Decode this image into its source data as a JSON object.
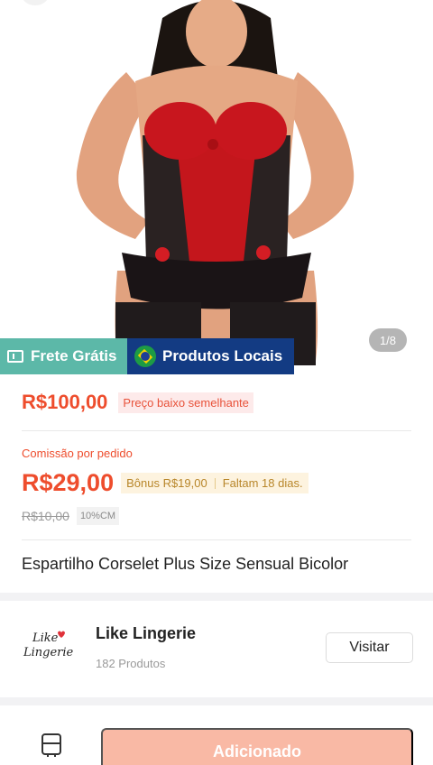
{
  "gallery": {
    "pager": "1/8",
    "tag_free_shipping": "Frete Grátis",
    "tag_local_products": "Produtos Locais"
  },
  "price": {
    "value": "R$100,00",
    "similar_badge": "Preço baixo semelhante"
  },
  "commission": {
    "label": "Comissão por pedido",
    "value": "R$29,00",
    "bonus": "Bônus R$19,00",
    "remaining": "Faltam 18 dias.",
    "old_value": "R$10,00",
    "rate": "10%CM"
  },
  "product": {
    "title": "Espartilho Corselet Plus Size Sensual Bicolor"
  },
  "shop": {
    "logo_text_line1": "Like",
    "logo_text_line2": "Lingerie",
    "name": "Like Lingerie",
    "product_count": "182 Produtos",
    "visit_label": "Visitar"
  },
  "actions": {
    "add_label": "Adicionado"
  },
  "colors": {
    "accent": "#ee4d2d",
    "free_shipping_tag": "#5cb8a8",
    "local_tag": "#133b83",
    "add_button": "#f9b9a5"
  },
  "icons": [
    "back-icon",
    "shipping-icon",
    "brazil-flag-icon",
    "store-icon"
  ]
}
